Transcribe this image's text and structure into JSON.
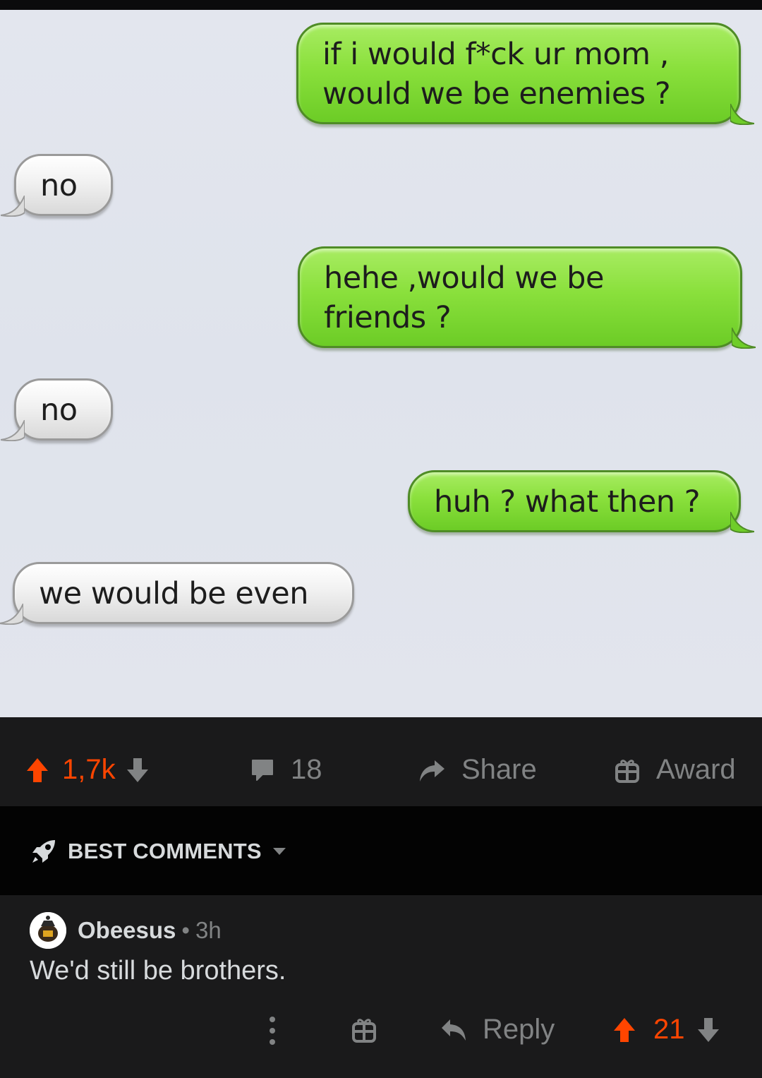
{
  "chat": {
    "messages": [
      {
        "side": "sent",
        "lines": [
          "if i would f*ck ur mom ,",
          "would we be enemies ?"
        ]
      },
      {
        "side": "received",
        "lines": [
          "no"
        ]
      },
      {
        "side": "sent",
        "lines": [
          "hehe ,would we be",
          "friends ?"
        ]
      },
      {
        "side": "received",
        "lines": [
          "no"
        ]
      },
      {
        "side": "sent",
        "lines": [
          "huh ? what then ?"
        ]
      },
      {
        "side": "received",
        "lines": [
          "we would be even"
        ]
      }
    ]
  },
  "post_actions": {
    "vote_count": "1,7k",
    "comment_count": "18",
    "share_label": "Share",
    "award_label": "Award"
  },
  "sort": {
    "label": "BEST COMMENTS"
  },
  "comment": {
    "author": "Obeesus",
    "separator": "•",
    "age": "3h",
    "body": "We'd still be brothers.",
    "reply_label": "Reply",
    "vote_count": "21"
  },
  "colors": {
    "upvote": "#ff4500",
    "muted": "#818384",
    "text": "#d7dadc",
    "sent_bubble": "#8ae03c",
    "received_bubble": "#f1f1f1"
  },
  "icons": {
    "upvote": "upvote-arrow-icon",
    "downvote": "downvote-arrow-icon",
    "comments": "comment-bubble-icon",
    "share": "share-arrow-icon",
    "award": "gift-icon",
    "sort": "rocket-icon",
    "dropdown": "caret-down-icon",
    "more": "more-vertical-icon",
    "reply": "reply-arrow-icon"
  }
}
